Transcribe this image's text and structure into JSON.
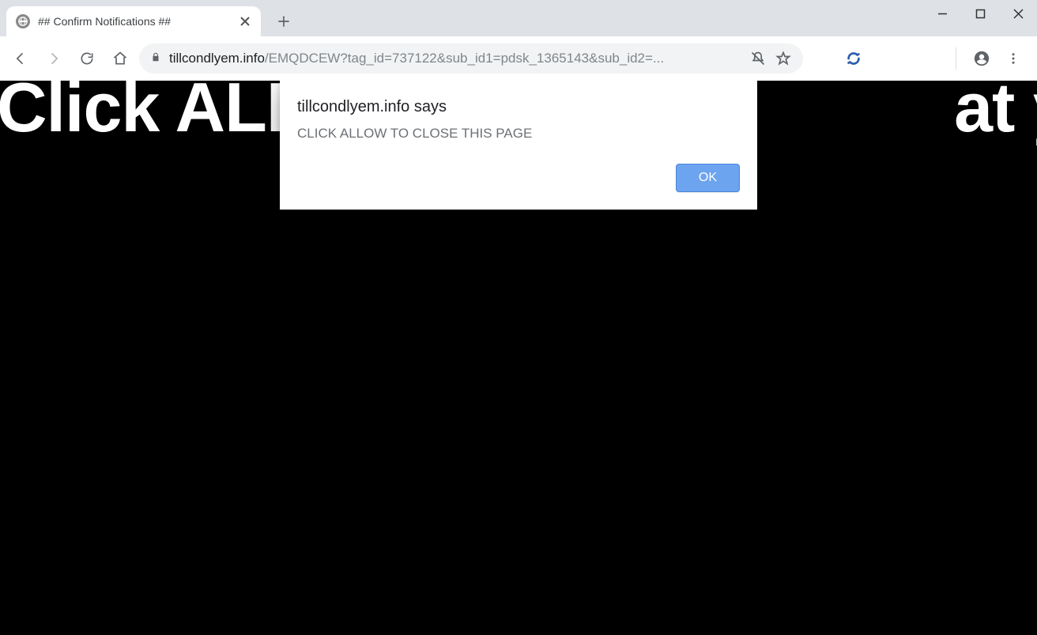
{
  "window": {
    "minimize_title": "Minimize",
    "maximize_title": "Maximize",
    "close_title": "Close"
  },
  "tab": {
    "title": "## Confirm Notifications ##",
    "close_title": "Close tab",
    "new_tab_title": "New tab"
  },
  "nav": {
    "back_title": "Back",
    "forward_title": "Forward",
    "reload_title": "Reload",
    "home_title": "Home"
  },
  "address": {
    "host": "tillcondlyem.info",
    "path": "/EMQDCEW?tag_id=737122&sub_id1=pdsk_1365143&sub_id2=...",
    "secure_title": "Secure",
    "notif_muted_title": "Notifications muted",
    "bookmark_title": "Bookmark this page"
  },
  "extension": {
    "refresh_title": "Extension"
  },
  "profile": {
    "title": "Profile"
  },
  "menu": {
    "title": "Customize and control"
  },
  "page": {
    "headline_left": "Click ALLO",
    "headline_right": "at you are"
  },
  "alert": {
    "origin": "tillcondlyem.info says",
    "message": "CLICK ALLOW TO CLOSE THIS PAGE",
    "ok_label": "OK"
  }
}
